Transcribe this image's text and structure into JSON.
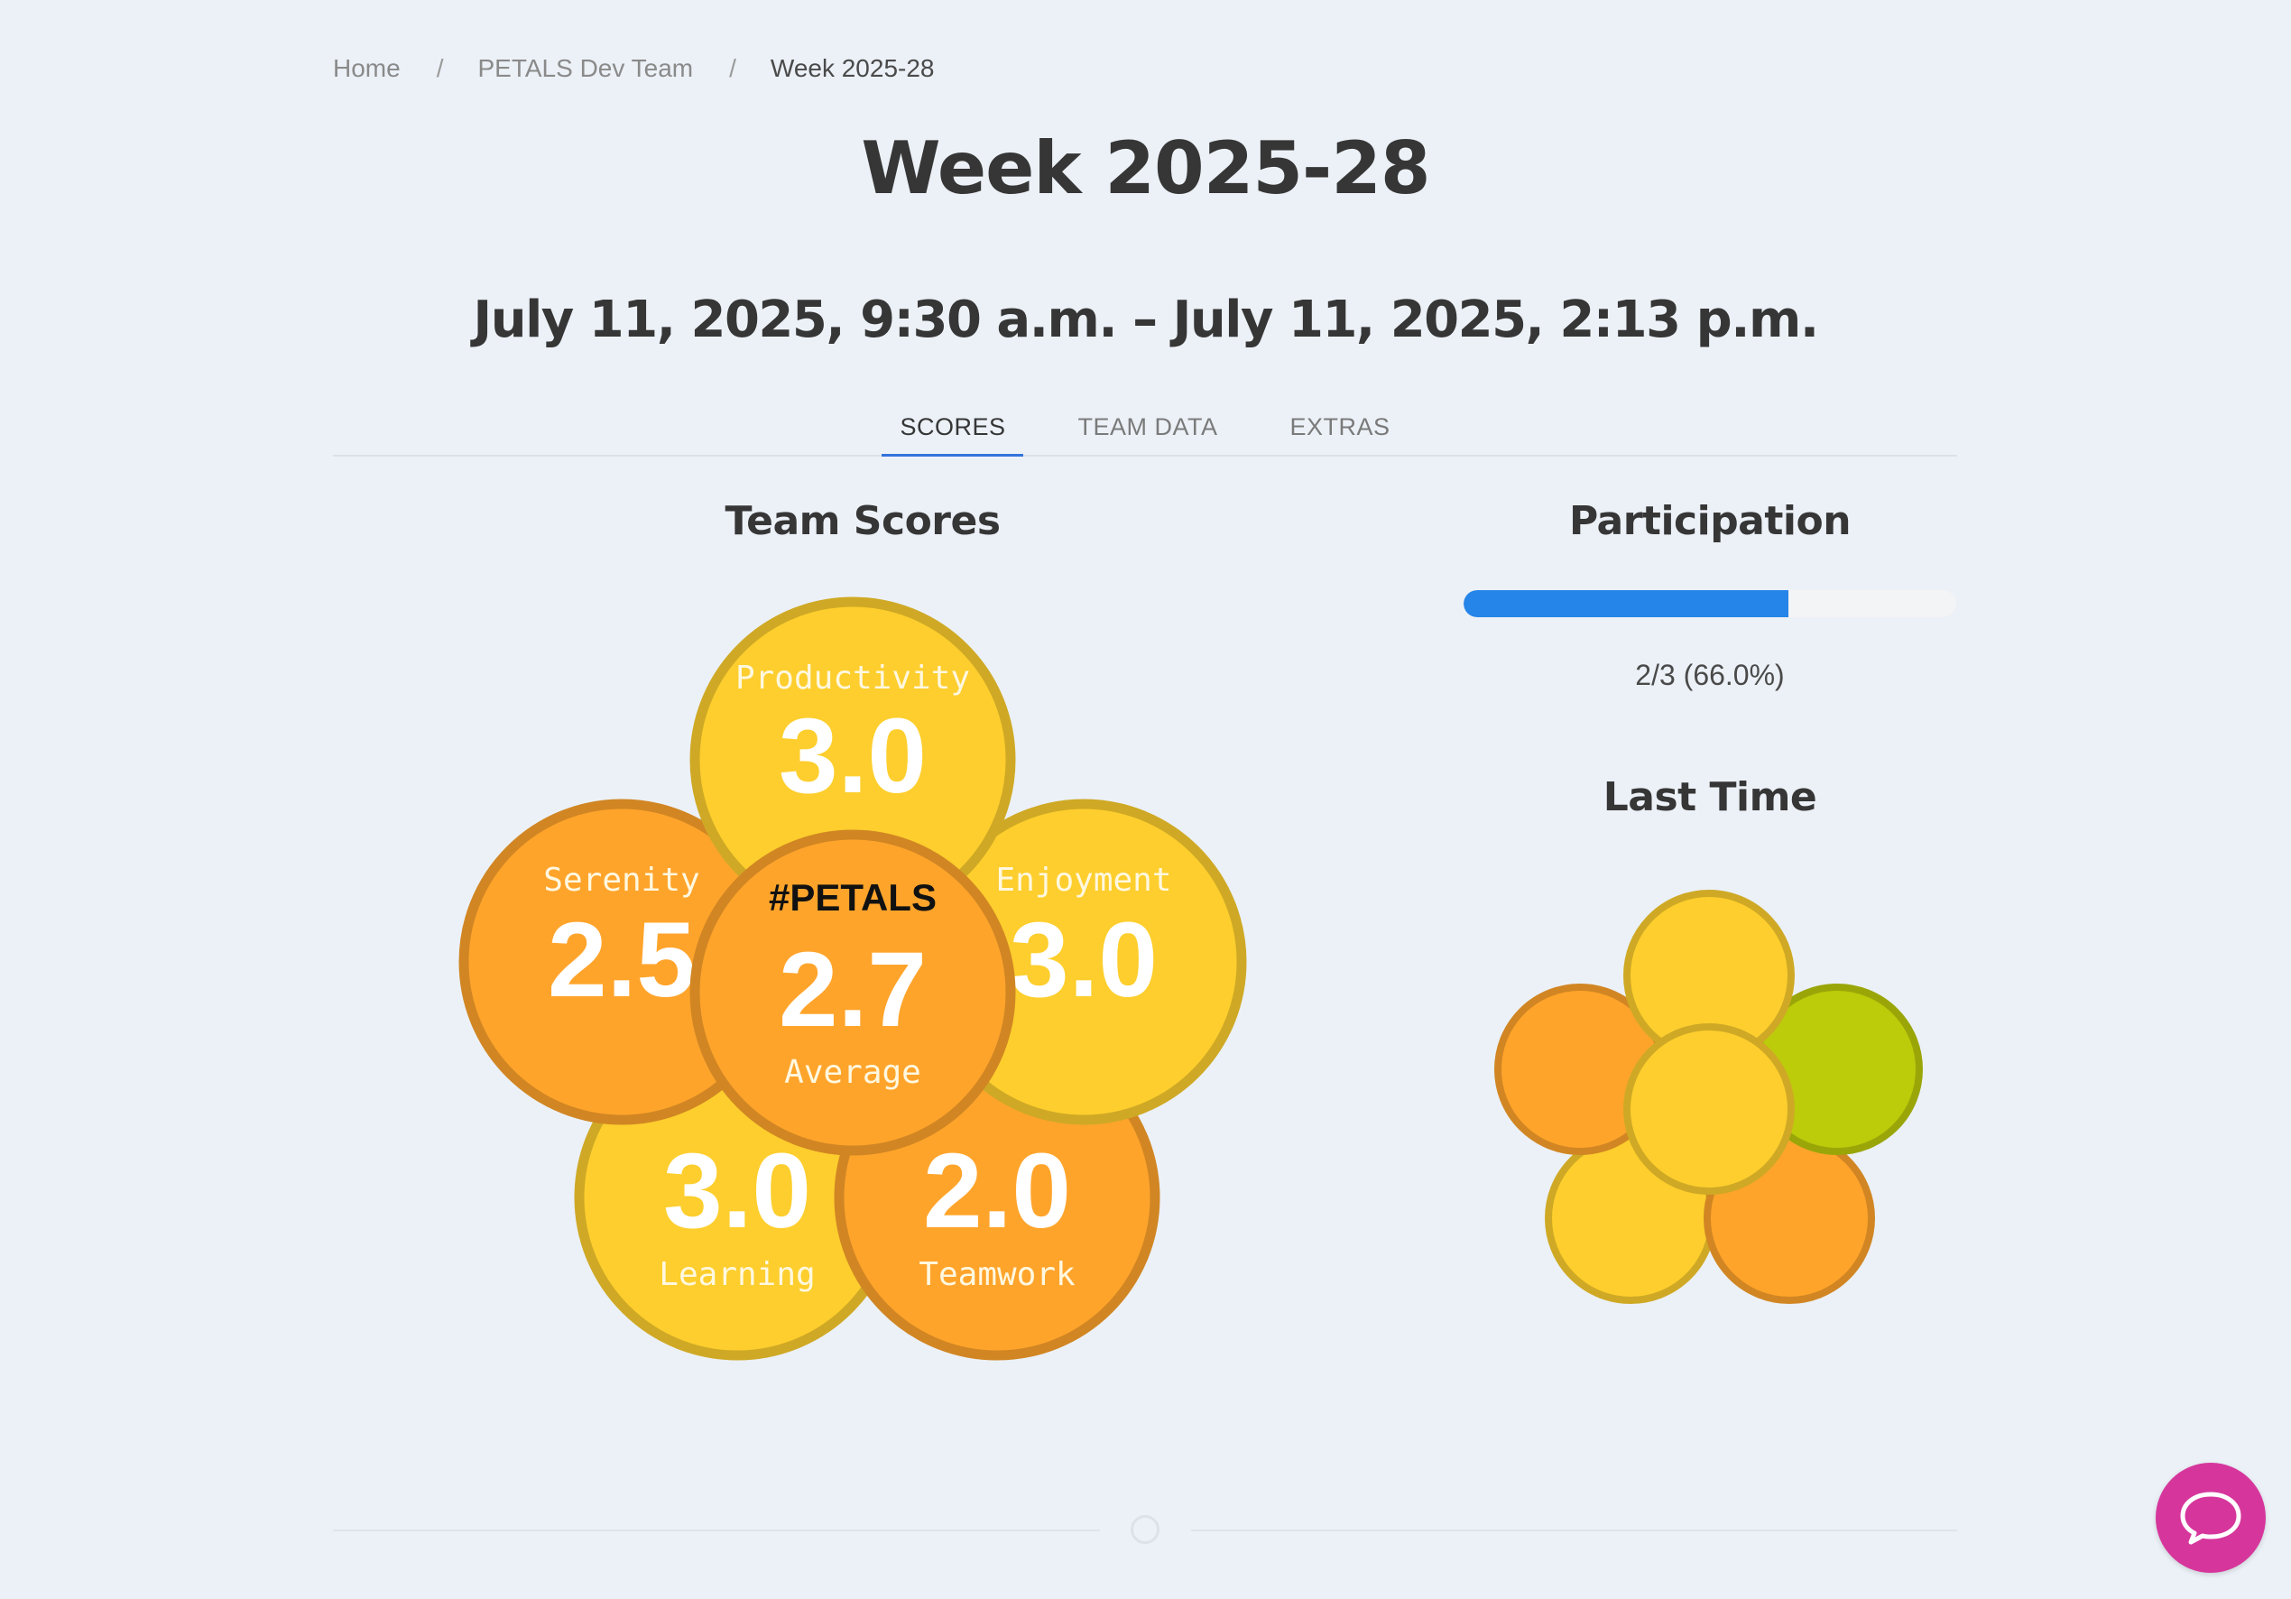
{
  "breadcrumb": {
    "home": "Home",
    "team": "PETALS Dev Team",
    "current": "Week 2025-28",
    "separator": "/"
  },
  "page": {
    "title": "Week 2025-28",
    "date_range": "July 11, 2025, 9:30 a.m. – July 11, 2025, 2:13 p.m."
  },
  "tabs": [
    {
      "label": "SCORES",
      "active": true
    },
    {
      "label": "TEAM DATA",
      "active": false
    },
    {
      "label": "EXTRAS",
      "active": false
    }
  ],
  "team_scores": {
    "title": "Team Scores",
    "center": {
      "tag": "#PETALS",
      "score": "2.7",
      "label": "Average",
      "color": "#ffa42b"
    },
    "petals": [
      {
        "name": "Productivity",
        "score": "3.0",
        "color": "#fdce2d"
      },
      {
        "name": "Enjoyment",
        "score": "3.0",
        "color": "#fdce2d"
      },
      {
        "name": "Serenity",
        "score": "2.5",
        "color": "#ffa42b"
      },
      {
        "name": "Learning",
        "score": "3.0",
        "color": "#fdce2d"
      },
      {
        "name": "Teamwork",
        "score": "2.0",
        "color": "#ffa42b"
      }
    ]
  },
  "participation": {
    "title": "Participation",
    "fraction": 0.66,
    "text": "2/3 (66.0%)",
    "bar_color": "#2585e8"
  },
  "last_time": {
    "title": "Last Time",
    "center_color": "#fdce2d",
    "petal_colors": [
      "#fdce2d",
      "#bccb0a",
      "#ffa42b",
      "#fdce2d",
      "#ffa42b"
    ]
  },
  "chat": {
    "icon": "chat-bubble-icon",
    "color": "#d6369c"
  }
}
